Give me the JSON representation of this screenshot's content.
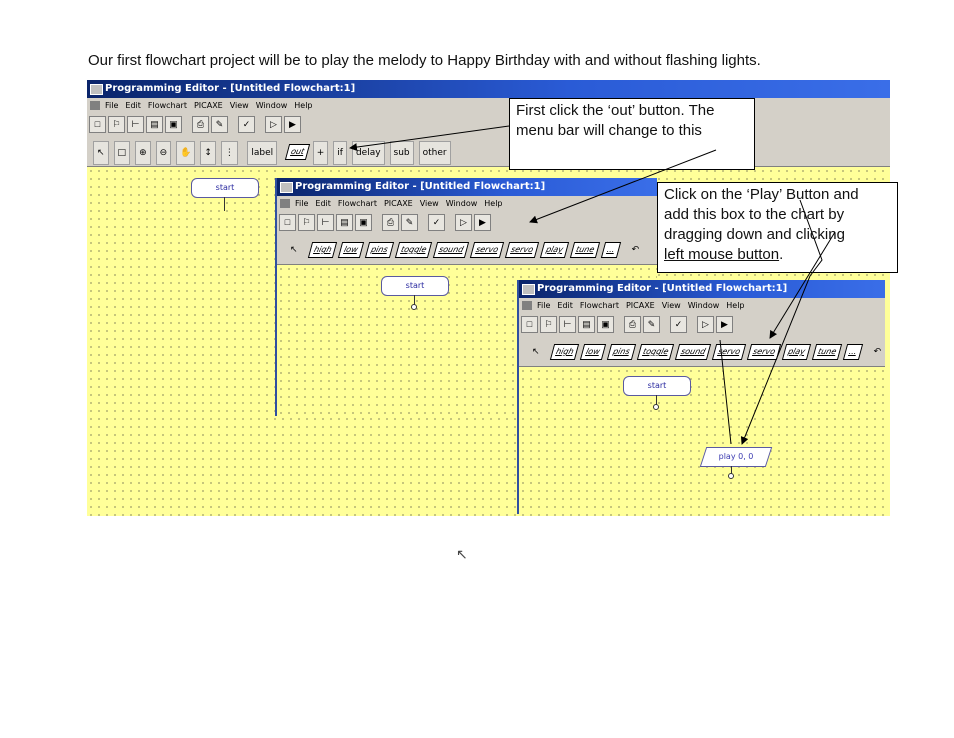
{
  "intro_text": "Our first flowchart project will be to play the melody to Happy Birthday with and without flashing lights.",
  "window_title": "Programming Editor  - [Untitled Flowchart:1]",
  "menu": [
    "File",
    "Edit",
    "Flowchart",
    "PICAXE",
    "View",
    "Window",
    "Help"
  ],
  "toolbar_main": [
    "new",
    "flowchart",
    "open",
    "open-folder",
    "save",
    "print",
    "settings",
    "check",
    "run",
    "step"
  ],
  "toolbar_flow": {
    "tools": [
      "select",
      "select-area",
      "zoom-in",
      "zoom-out",
      "pan",
      "line",
      "line-vertical"
    ],
    "label": "label",
    "items": [
      "out",
      "+",
      "if",
      "delay",
      "sub",
      "other"
    ]
  },
  "toolbar_out": {
    "items": [
      "high",
      "low",
      "pins",
      "toggle",
      "sound",
      "servo",
      "servo",
      "play",
      "tune",
      "..."
    ],
    "undo": "undo"
  },
  "flowchart": {
    "start_label": "start",
    "play_label": "play  0, 0"
  },
  "callout1": {
    "line1": "First click the ‘out’ button. The",
    "line2": "menu bar will change to this"
  },
  "callout2": {
    "line1": "Click on the ‘Play’ Button and",
    "line2": "add this box to the chart by",
    "line3": "dragging down and clicking",
    "line4": "left mouse button",
    "line4_suffix": "."
  },
  "colors": {
    "canvas": "#ffff99",
    "titlebar": "#0a246a",
    "arrow": "#000000"
  }
}
